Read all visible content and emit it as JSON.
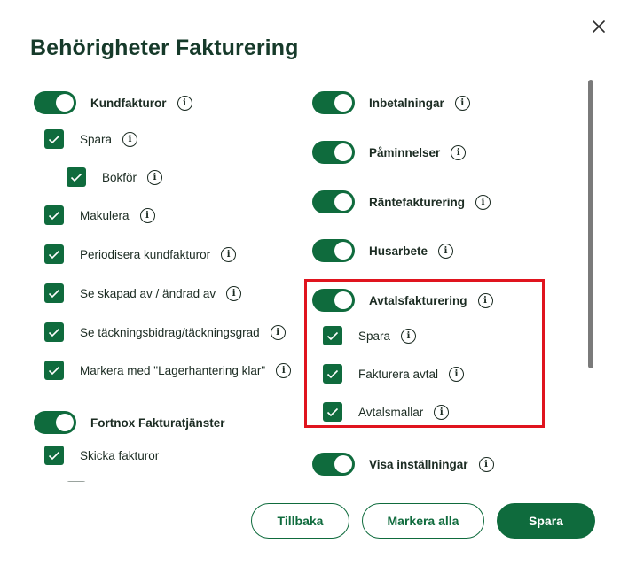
{
  "dialog": {
    "title": "Behörigheter Fakturering",
    "close_label": "×"
  },
  "left": {
    "kundfakturor": {
      "label": "Kundfakturor",
      "items": {
        "spara": "Spara",
        "bokfor": "Bokför",
        "makulera": "Makulera",
        "periodisera": "Periodisera kundfakturor",
        "skapad": "Se skapad av / ändrad av",
        "tackning": "Se täckningsbidrag/täckningsgrad",
        "lager": "Markera med \"Lagerhantering klar\""
      }
    },
    "fortnox": {
      "label": "Fortnox Fakturatjänster",
      "items": {
        "skicka": "Skicka fakturor"
      }
    }
  },
  "right": {
    "inbetalningar": "Inbetalningar",
    "paminnelser": "Påminnelser",
    "rantefakturering": "Räntefakturering",
    "husarbete": "Husarbete",
    "avtalsfakturering": {
      "label": "Avtalsfakturering",
      "items": {
        "spara": "Spara",
        "fakturera": "Fakturera avtal",
        "mallar": "Avtalsmallar"
      }
    },
    "visa": "Visa inställningar"
  },
  "info_glyph": "i",
  "footer": {
    "back": "Tillbaka",
    "select_all": "Markera alla",
    "save": "Spara"
  },
  "colors": {
    "accent": "#0f6b3d",
    "highlight": "#e0141e"
  }
}
